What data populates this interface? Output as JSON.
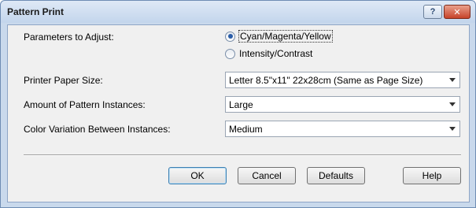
{
  "window": {
    "title": "Pattern Print",
    "help_glyph": "?",
    "close_glyph": "✕"
  },
  "form": {
    "parameters": {
      "label": "Parameters to Adjust:",
      "options": [
        {
          "label": "Cyan/Magenta/Yellow",
          "selected": true
        },
        {
          "label": "Intensity/Contrast",
          "selected": false
        }
      ]
    },
    "paper_size": {
      "label": "Printer Paper Size:",
      "value": "Letter 8.5\"x11\" 22x28cm (Same as Page Size)"
    },
    "instances": {
      "label": "Amount of Pattern Instances:",
      "value": "Large"
    },
    "variation": {
      "label": "Color Variation Between Instances:",
      "value": "Medium"
    }
  },
  "buttons": {
    "ok": "OK",
    "cancel": "Cancel",
    "defaults": "Defaults",
    "help": "Help"
  }
}
